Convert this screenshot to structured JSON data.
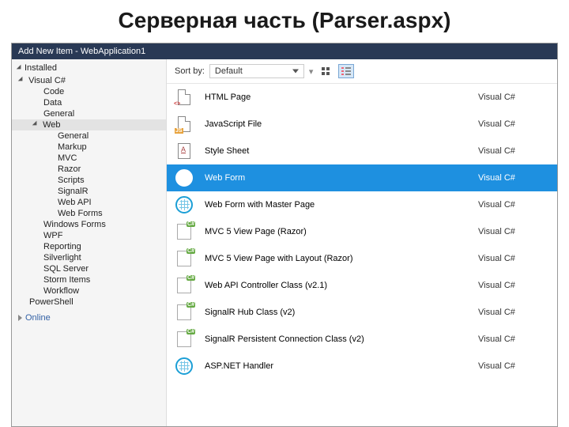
{
  "page_title": "Серверная часть (Parser.aspx)",
  "dialog_title": "Add New Item - WebApplication1",
  "sidebar": {
    "installed": "Installed",
    "online": "Online",
    "tree": {
      "root": "Visual C#",
      "items1": [
        "Code",
        "Data",
        "General"
      ],
      "web": "Web",
      "web_children": [
        "General",
        "Markup",
        "MVC",
        "Razor",
        "Scripts",
        "SignalR",
        "Web API",
        "Web Forms"
      ],
      "items2": [
        "Windows Forms",
        "WPF",
        "Reporting",
        "Silverlight",
        "SQL Server",
        "Storm Items",
        "Workflow"
      ],
      "powershell": "PowerShell"
    }
  },
  "toolbar": {
    "sort_label": "Sort by:",
    "sort_value": "Default"
  },
  "items": [
    {
      "icon": "html",
      "name": "HTML Page",
      "lang": "Visual C#"
    },
    {
      "icon": "js",
      "name": "JavaScript File",
      "lang": "Visual C#"
    },
    {
      "icon": "css",
      "name": "Style Sheet",
      "lang": "Visual C#"
    },
    {
      "icon": "globe",
      "name": "Web Form",
      "lang": "Visual C#",
      "selected": true
    },
    {
      "icon": "globe",
      "name": "Web Form with Master Page",
      "lang": "Visual C#"
    },
    {
      "icon": "cs",
      "name": "MVC 5 View Page (Razor)",
      "lang": "Visual C#"
    },
    {
      "icon": "cs",
      "name": "MVC 5 View Page with Layout (Razor)",
      "lang": "Visual C#"
    },
    {
      "icon": "cs",
      "name": "Web API Controller Class (v2.1)",
      "lang": "Visual C#"
    },
    {
      "icon": "cs",
      "name": "SignalR Hub Class (v2)",
      "lang": "Visual C#"
    },
    {
      "icon": "cs",
      "name": "SignalR Persistent Connection Class (v2)",
      "lang": "Visual C#"
    },
    {
      "icon": "globe",
      "name": "ASP.NET Handler",
      "lang": "Visual C#"
    }
  ]
}
